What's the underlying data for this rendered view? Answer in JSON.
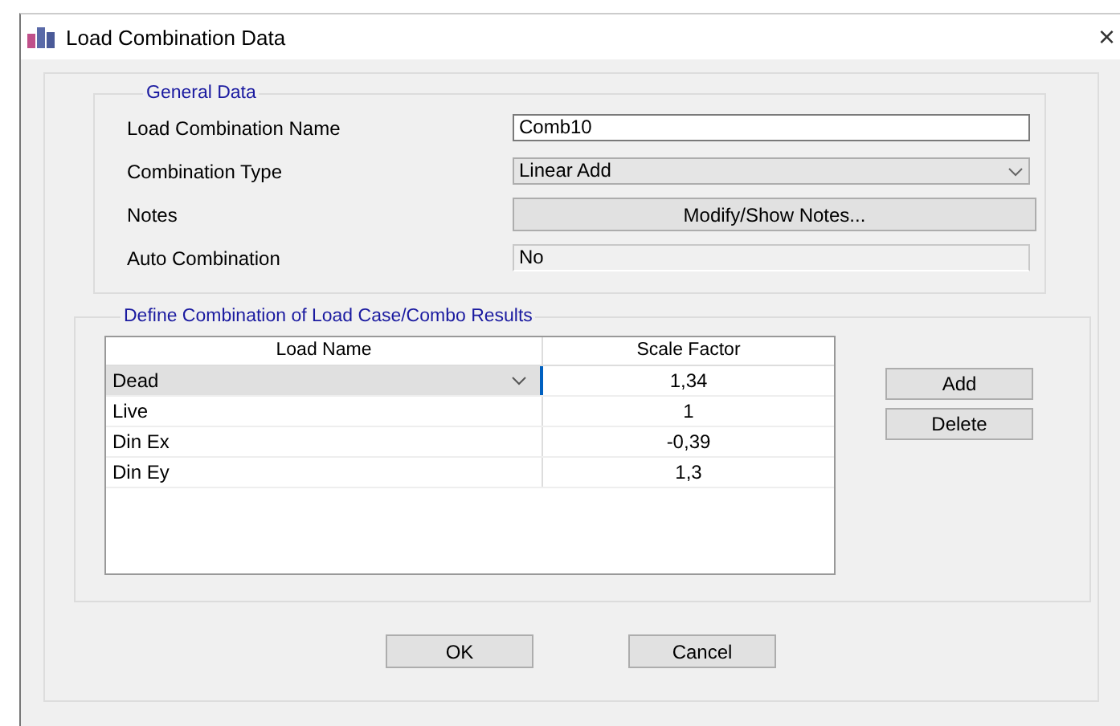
{
  "window": {
    "title": "Load Combination Data",
    "close": "×"
  },
  "general_data": {
    "title": "General Data",
    "fields": [
      {
        "kind": "text",
        "label": "Load Combination Name",
        "value": "Comb10"
      },
      {
        "kind": "dropdown",
        "label": "Combination Type",
        "value": "Linear Add"
      },
      {
        "kind": "button",
        "label": "Notes",
        "value": "Modify/Show Notes..."
      },
      {
        "kind": "readonly",
        "label": "Auto Combination",
        "value": "No"
      }
    ]
  },
  "combination": {
    "title": "Define Combination of Load Case/Combo Results",
    "table": {
      "columns": [
        "Load Name",
        "Scale Factor"
      ],
      "rows": [
        {
          "load_name": "Dead",
          "scale_factor": "1,34",
          "selected": true
        },
        {
          "load_name": "Live",
          "scale_factor": "1",
          "selected": false
        },
        {
          "load_name": "Din Ex",
          "scale_factor": "-0,39",
          "selected": false
        },
        {
          "load_name": "Din Ey",
          "scale_factor": "1,3",
          "selected": false
        }
      ]
    },
    "buttons": [
      "Add",
      "Delete"
    ]
  },
  "buttons": [
    "OK",
    "Cancel"
  ]
}
